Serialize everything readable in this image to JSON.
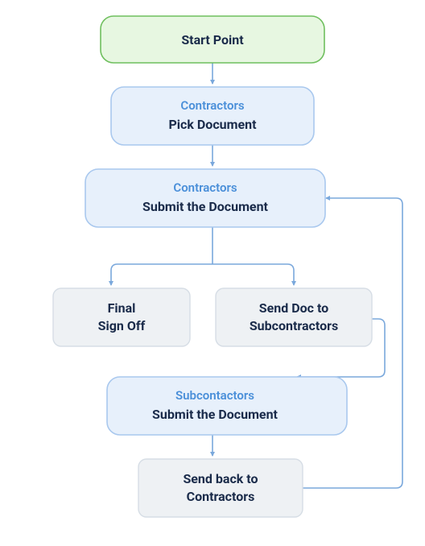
{
  "colors": {
    "green_fill": "#e7f7e1",
    "green_stroke": "#6fbf5e",
    "blue_fill": "#e7f0fb",
    "blue_stroke": "#a9c8ee",
    "grey_fill": "#eef1f4",
    "grey_stroke": "#d6dde5",
    "arrow": "#7aa8dc",
    "text_dark": "#1a2b4a",
    "text_blue": "#4a8fd9"
  },
  "nodes": {
    "start": {
      "label": "Start Point"
    },
    "pick": {
      "role": "Contractors",
      "action": "Pick Document"
    },
    "submit_contractor": {
      "role": "Contractors",
      "action": "Submit the Document"
    },
    "final": {
      "line1": "Final",
      "line2": "Sign Off"
    },
    "send_sub": {
      "line1": "Send Doc to",
      "line2": "Subcontractors"
    },
    "submit_sub": {
      "role": "Subcontactors",
      "action": "Submit the Document"
    },
    "send_back": {
      "line1": "Send back to",
      "line2": "Contractors"
    }
  }
}
